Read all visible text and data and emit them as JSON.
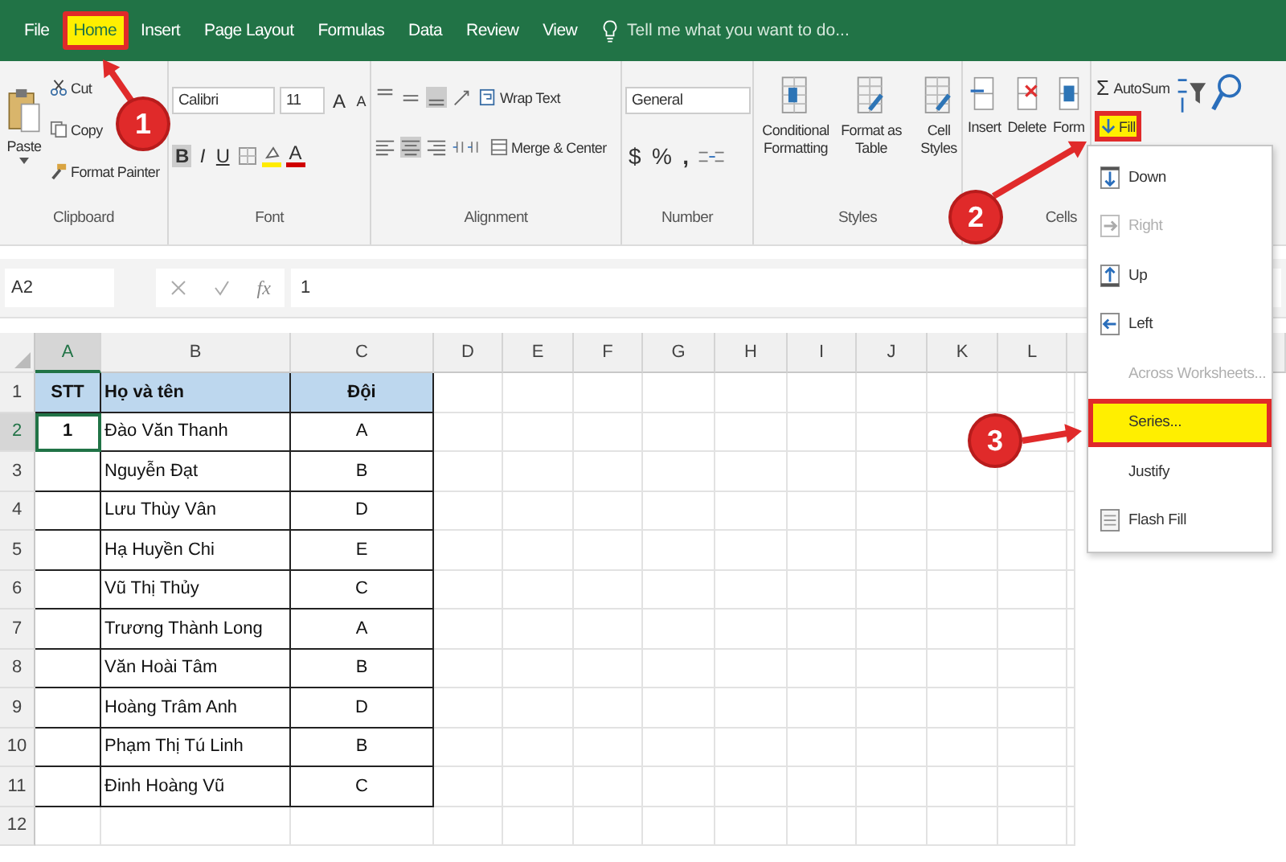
{
  "tabs": [
    {
      "label": "File",
      "selected": false
    },
    {
      "label": "Home",
      "selected": true
    },
    {
      "label": "Insert",
      "selected": false
    },
    {
      "label": "Page Layout",
      "selected": false
    },
    {
      "label": "Formulas",
      "selected": false
    },
    {
      "label": "Data",
      "selected": false
    },
    {
      "label": "Review",
      "selected": false
    },
    {
      "label": "View",
      "selected": false
    }
  ],
  "tell_me": {
    "placeholder": "Tell me what you want to do..."
  },
  "ribbon": {
    "clipboard": {
      "paste": "Paste",
      "cut": "Cut",
      "copy": "Copy",
      "format_painter": "Format Painter",
      "label": "Clipboard"
    },
    "font": {
      "family": "Calibri",
      "size": "11",
      "grow": "A",
      "shrink": "A",
      "bold": "B",
      "italic": "I",
      "underline": "U",
      "font_color_letter": "A",
      "label": "Font"
    },
    "alignment": {
      "wrap_text": "Wrap Text",
      "merge_center": "Merge & Center",
      "label": "Alignment"
    },
    "number": {
      "format": "General",
      "currency": "$",
      "percent": "%",
      "comma": ",",
      "label": "Number"
    },
    "styles": {
      "buttons": [
        "Conditional Formatting",
        "Format as Table",
        "Cell Styles"
      ],
      "label": "Styles"
    },
    "cells": {
      "buttons": [
        "Insert",
        "Delete",
        "Form"
      ],
      "label": "Cells"
    },
    "editing": {
      "autosum_symbol": "Σ",
      "autosum": "AutoSum",
      "fill": "Fill",
      "fill_highlighted": true
    }
  },
  "formula_bar": {
    "name_box": "A2",
    "function_symbol": "fx",
    "value": "1"
  },
  "sheet": {
    "columns": [
      {
        "label": "A",
        "selected": true
      },
      {
        "label": "B",
        "selected": false
      },
      {
        "label": "C",
        "selected": false
      },
      {
        "label": "D",
        "selected": false
      },
      {
        "label": "E",
        "selected": false
      },
      {
        "label": "F",
        "selected": false
      },
      {
        "label": "G",
        "selected": false
      },
      {
        "label": "H",
        "selected": false
      },
      {
        "label": "I",
        "selected": false
      },
      {
        "label": "J",
        "selected": false
      },
      {
        "label": "K",
        "selected": false
      },
      {
        "label": "L",
        "selected": false
      }
    ],
    "rows": [
      {
        "label": "1",
        "selected": false,
        "kind": "header",
        "cells": [
          "STT",
          "Họ và tên",
          "Đội"
        ]
      },
      {
        "label": "2",
        "selected": true,
        "kind": "data",
        "cells": [
          "1",
          "Đào Văn Thanh",
          "A"
        ]
      },
      {
        "label": "3",
        "selected": false,
        "kind": "data",
        "cells": [
          "",
          "Nguyễn Đạt",
          "B"
        ]
      },
      {
        "label": "4",
        "selected": false,
        "kind": "data",
        "cells": [
          "",
          "Lưu Thùy Vân",
          "D"
        ]
      },
      {
        "label": "5",
        "selected": false,
        "kind": "data",
        "cells": [
          "",
          "Hạ Huyền Chi",
          "E"
        ]
      },
      {
        "label": "6",
        "selected": false,
        "kind": "data",
        "cells": [
          "",
          "Vũ Thị Thủy",
          "C"
        ]
      },
      {
        "label": "7",
        "selected": false,
        "kind": "data",
        "cells": [
          "",
          "Trương Thành Long",
          "A"
        ]
      },
      {
        "label": "8",
        "selected": false,
        "kind": "data",
        "cells": [
          "",
          "Văn Hoài Tâm",
          "B"
        ]
      },
      {
        "label": "9",
        "selected": false,
        "kind": "data",
        "cells": [
          "",
          "Hoàng Trâm Anh",
          "D"
        ]
      },
      {
        "label": "10",
        "selected": false,
        "kind": "data",
        "cells": [
          "",
          "Phạm Thị Tú Linh",
          "B"
        ]
      },
      {
        "label": "11",
        "selected": false,
        "kind": "data",
        "cells": [
          "",
          "Đinh Hoàng Vũ",
          "C"
        ]
      },
      {
        "label": "12",
        "selected": false,
        "kind": "empty"
      }
    ]
  },
  "fill_menu": {
    "items": [
      {
        "label": "Down",
        "disabled": false,
        "selected": false
      },
      {
        "label": "Right",
        "disabled": true,
        "selected": false
      },
      {
        "label": "Up",
        "disabled": false,
        "selected": false
      },
      {
        "label": "Left",
        "disabled": false,
        "selected": false
      },
      {
        "label": "Across Worksheets...",
        "disabled": true,
        "selected": false
      },
      {
        "label": "Series...",
        "disabled": false,
        "selected": true
      },
      {
        "label": "Justify",
        "disabled": false,
        "selected": false
      },
      {
        "label": "Flash Fill",
        "disabled": false,
        "selected": false
      }
    ]
  },
  "callouts": [
    {
      "number": "1"
    },
    {
      "number": "2"
    },
    {
      "number": "3"
    }
  ]
}
